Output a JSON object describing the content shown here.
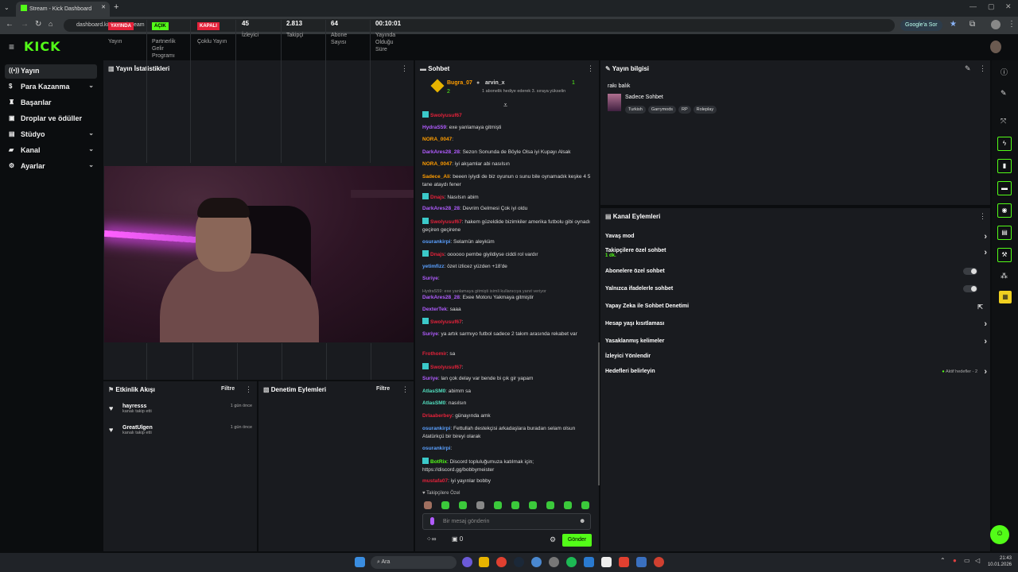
{
  "browser": {
    "tab_title": "Stream - Kick Dashboard",
    "new_tab": "+",
    "url": "dashboard.kick.com/stream",
    "google_button": "Google'a Sor"
  },
  "app": {
    "logo": "KICK"
  },
  "sidebar": {
    "items": [
      {
        "label": "Yayın",
        "icon": "broadcast-icon"
      },
      {
        "label": "Para Kazanma",
        "icon": "money-icon"
      },
      {
        "label": "Başarılar",
        "icon": "trophy-icon"
      },
      {
        "label": "Droplar ve ödüller",
        "icon": "gift-icon"
      },
      {
        "label": "Stüdyo",
        "icon": "studio-icon"
      },
      {
        "label": "Kanal",
        "icon": "channel-icon"
      },
      {
        "label": "Ayarlar",
        "icon": "gear-icon"
      }
    ]
  },
  "stats": {
    "title": "Yayın İstatistikleri",
    "items": [
      {
        "badge": "YAYINDA",
        "label": "Yayın"
      },
      {
        "badge": "AÇIK",
        "label": "Partnerlik Gelir Programı"
      },
      {
        "badge": "KAPALI",
        "label": "Çoklu Yayın"
      },
      {
        "value": "45",
        "label": "İzleyici"
      },
      {
        "value": "2.813",
        "label": "Takipçi"
      },
      {
        "value": "64",
        "label": "Abone Sayısı"
      },
      {
        "value": "00:10:01",
        "label": "Yayında Olduğu Süre"
      }
    ]
  },
  "activity": {
    "title": "Etkinlik Akışı",
    "filter": "Filtre",
    "items": [
      {
        "name": "hayresss",
        "desc": "kanalı takip etti",
        "time": "1 gün önce"
      },
      {
        "name": "GreatUlgen",
        "desc": "kanalı takip etti",
        "time": "1 gün önce"
      }
    ]
  },
  "moderation": {
    "title": "Denetim Eylemleri",
    "filter": "Filtre"
  },
  "chat": {
    "title": "Sohbet",
    "pinned": {
      "user1": "Bugra_07",
      "user2": "arvin_x",
      "count1": "2",
      "count2": "1",
      "note": "1 abonelik hediye ederek 3. sıraya yükselin"
    },
    "messages": [
      {
        "user": "Swolyusuf67",
        "text": "",
        "color": "#e4223a"
      },
      {
        "user": "HydraS59",
        "text": ": exe yanlamaya gitmişti",
        "color": "#b15cff"
      },
      {
        "user": "NORA_0047",
        "text": ":",
        "color": "#ff9d00"
      },
      {
        "user": "DarkAres28_28",
        "text": ": Sezon Sonunda de Böyle Olsa iyi Kupayı Alsak",
        "color": "#b15cff"
      },
      {
        "user": "NORA_0047",
        "text": ": iyi akşamlar abi nasılsın",
        "color": "#ff9d00"
      },
      {
        "user": "Sadece_Ali",
        "text": ": beeen iyiydi de biz oyunun o sunu bile oynamadık keşke 4 5 tane ataydı fener",
        "color": "#ff9d00"
      },
      {
        "user": "Dnajs",
        "text": ": Nasılsın abim",
        "color": "#e4223a"
      },
      {
        "user": "DarkAres28_28",
        "text": ": Devrim Gelmesi Çok iyi oldu",
        "color": "#b15cff"
      },
      {
        "user": "Swolyusuf67",
        "text": ": hakem güzeldide bizimkiler amerika futbolu gibi oynadı geçiren geçirene",
        "color": "#e4223a"
      },
      {
        "user": "osurankirpi",
        "text": ": Selamün aleyküm",
        "color": "#5aa0ff"
      },
      {
        "user": "Dnajs",
        "text": ": oooooo pembe giyildiyse ciddi rol vardır",
        "color": "#e4223a"
      },
      {
        "user": "yetimfizz",
        "text": ": özet izlicez yüzden +18'de",
        "color": "#5aa0ff"
      },
      {
        "user": "Suriye",
        "text": ":",
        "color": "#b15cff"
      },
      {
        "user": "",
        "text": "HydraS59: exe yanlamaya gitmişti isimli kullanıcıya yanıt veriyor",
        "color": "#888"
      },
      {
        "user": "DarkAres28_28",
        "text": ": Exee Motoru Yakmaya gitmiştir",
        "color": "#b15cff"
      },
      {
        "user": "DexterTek",
        "text": ": saaa",
        "color": "#b15cff"
      },
      {
        "user": "Swolyusuf67",
        "text": ":",
        "color": "#e4223a"
      },
      {
        "user": "Suriye",
        "text": ": ya artık sarmıyo futbol sadece 2 takım arasında rekabet var",
        "color": "#b15cff"
      },
      {
        "user": "Frothomir",
        "text": ": sa",
        "color": "#e4223a"
      },
      {
        "user": "Swolyusuf67",
        "text": ":",
        "color": "#e4223a"
      },
      {
        "user": "Suriye",
        "text": ": lan çok delay var bende bi çık gir yapam",
        "color": "#b15cff"
      },
      {
        "user": "AtlasSM0",
        "text": ": abimm sa",
        "color": "#53e0c0"
      },
      {
        "user": "AtlasSM0",
        "text": ": nasılsın",
        "color": "#53e0c0"
      },
      {
        "user": "Drlaaberbey",
        "text": ": günayında amk",
        "color": "#e4223a"
      },
      {
        "user": "osurankirpi",
        "text": ": Fettullah destekçisi arkadaşlara buradan selam olsun Atatürkçü bir bireyi olarak",
        "color": "#5aa0ff"
      },
      {
        "user": "osurankirpi",
        "text": ":",
        "color": "#5aa0ff"
      },
      {
        "user": "BotRix",
        "text": ": Discord topluluğumuza katılmak için; https://discord.gg/bobbymeister",
        "color": "#53fc18"
      },
      {
        "user": "mustafa07",
        "text": ": iyi yayınlar bobby",
        "color": "#e4223a"
      }
    ],
    "followers_only": "Takipçilere Özel",
    "input_placeholder": "Bir mesaj gönderin",
    "infinity": "∞",
    "counter": "0",
    "send": "Gönder"
  },
  "stream_info": {
    "title": "Yayın bilgisi",
    "stream_title": "rakı balık",
    "category": "Sadece Sohbet",
    "tags": [
      "Turkish",
      "Garrymods",
      "RP",
      "Roleplay"
    ]
  },
  "channel_actions": {
    "title": "Kanal Eylemleri",
    "rows": [
      {
        "label": "Yavaş mod",
        "ctrl": "chevron"
      },
      {
        "label": "Takipçilere özel sohbet",
        "sub": "1 dk.",
        "ctrl": "chevron"
      },
      {
        "label": "Abonelere özel sohbet",
        "ctrl": "toggle"
      },
      {
        "label": "Yalnızca ifadelerle sohbet",
        "ctrl": "toggle"
      },
      {
        "label": "Yapay Zeka ile Sohbet Denetimi",
        "ctrl": "external"
      },
      {
        "label": "Hesap yaşı kısıtlaması",
        "ctrl": "chevron"
      },
      {
        "label": "Yasaklanmış kelimeler",
        "ctrl": "chevron"
      },
      {
        "label": "İzleyici Yönlendir",
        "ctrl": ""
      },
      {
        "label": "Hedefleri belirleyin",
        "ctrl": "chevron",
        "status": "Aktif hedefler - 2"
      }
    ]
  },
  "taskbar": {
    "search": "Ara",
    "time": "21:43",
    "date": "10.01.2026"
  },
  "colors": {
    "accent": "#53fc18",
    "live": "#e4223a"
  }
}
